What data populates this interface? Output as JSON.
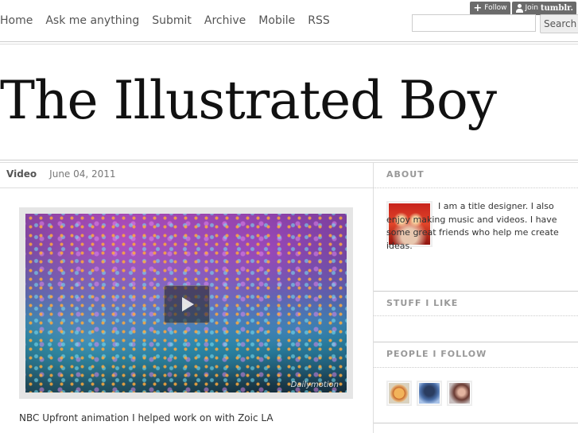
{
  "tumblr_controls": {
    "follow_label": "Follow",
    "join_label": "Join",
    "brand": "tumblr."
  },
  "nav": {
    "items": [
      "Home",
      "Ask me anything",
      "Submit",
      "Archive",
      "Mobile",
      "RSS"
    ]
  },
  "search": {
    "value": "",
    "placeholder": "",
    "button_label": "Search"
  },
  "site": {
    "title": "The Illustrated Boy"
  },
  "post": {
    "type": "Video",
    "date": "June 04, 2011",
    "video_brand": "Dailymotion",
    "caption": "NBC Upfront animation I helped work on with Zoic LA"
  },
  "sidebar": {
    "about": {
      "heading": "ABOUT",
      "text": "I am a title designer. I also enjoy making music and videos. I have some great friends who help me create ideas."
    },
    "stuff": {
      "heading": "STUFF I LIKE"
    },
    "people": {
      "heading": "PEOPLE I FOLLOW"
    }
  }
}
